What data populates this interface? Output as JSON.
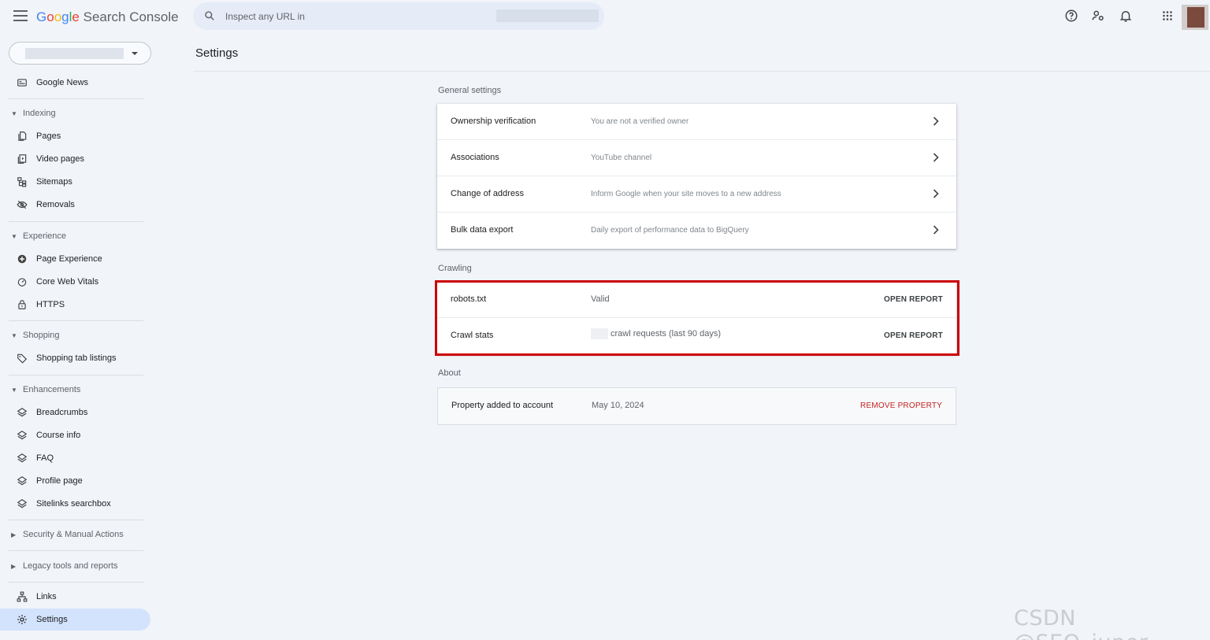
{
  "header": {
    "logo_google": [
      "G",
      "o",
      "o",
      "g",
      "l",
      "e"
    ],
    "logo_rest": " Search Console",
    "search_placeholder": "Inspect any URL in"
  },
  "sidebar": {
    "top_item": "Google News",
    "sections": {
      "indexing": "Indexing",
      "experience": "Experience",
      "shopping": "Shopping",
      "enhancements": "Enhancements",
      "security": "Security & Manual Actions",
      "legacy": "Legacy tools and reports"
    },
    "items": {
      "pages": "Pages",
      "video_pages": "Video pages",
      "sitemaps": "Sitemaps",
      "removals": "Removals",
      "page_experience": "Page Experience",
      "core_web_vitals": "Core Web Vitals",
      "https": "HTTPS",
      "shopping_tab": "Shopping tab listings",
      "breadcrumbs": "Breadcrumbs",
      "course_info": "Course info",
      "faq": "FAQ",
      "profile_page": "Profile page",
      "sitelinks": "Sitelinks searchbox",
      "links": "Links",
      "settings": "Settings"
    }
  },
  "main": {
    "title": "Settings",
    "general": {
      "label": "General settings",
      "rows": [
        {
          "key": "Ownership verification",
          "value": "You are not a verified owner"
        },
        {
          "key": "Associations",
          "value": "YouTube channel"
        },
        {
          "key": "Change of address",
          "value": "Inform Google when your site moves to a new address"
        },
        {
          "key": "Bulk data export",
          "value": "Daily export of performance data to BigQuery"
        }
      ]
    },
    "crawling": {
      "label": "Crawling",
      "rows": [
        {
          "key": "robots.txt",
          "value": "Valid",
          "action": "OPEN REPORT"
        },
        {
          "key": "Crawl stats",
          "value": "crawl requests (last 90 days)",
          "action": "OPEN REPORT"
        }
      ]
    },
    "about": {
      "label": "About",
      "row": {
        "key": "Property added to account",
        "value": "May 10, 2024",
        "action": "REMOVE PROPERTY"
      }
    }
  },
  "watermark": "CSDN @SEO_juper",
  "colors": {
    "accent": "#1a73e8",
    "active_nav": "#d3e3fd",
    "highlight_border": "#cc0000",
    "remove_red": "#c5221f"
  }
}
